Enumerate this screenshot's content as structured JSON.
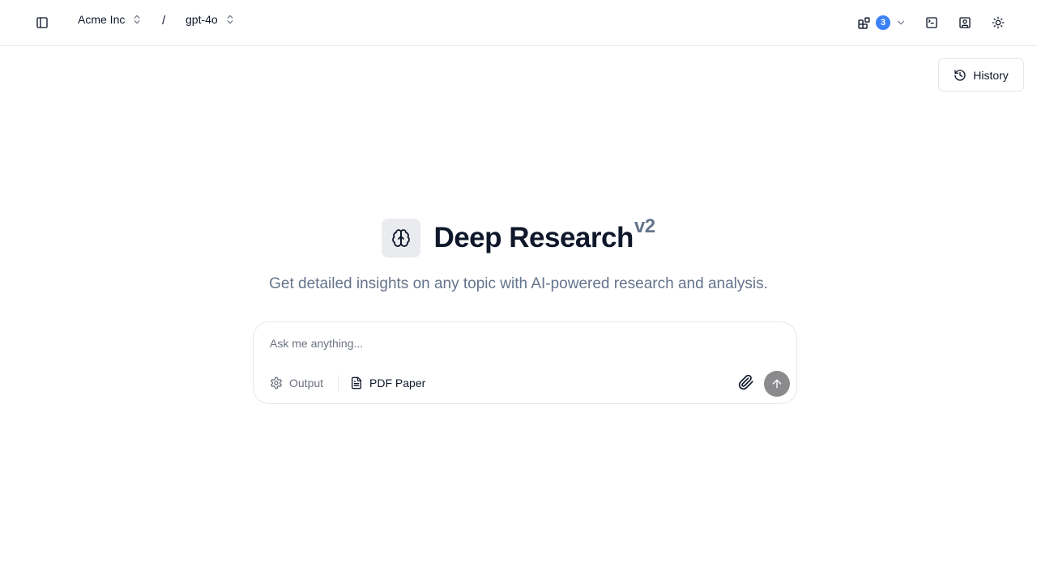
{
  "header": {
    "org_name": "Acme Inc",
    "separator": "/",
    "model_name": "gpt-4o",
    "apps_badge_count": "3"
  },
  "history": {
    "label": "History"
  },
  "hero": {
    "title": "Deep Research",
    "version": "v2",
    "subtitle": "Get detailed insights on any topic with AI-powered research and analysis."
  },
  "composer": {
    "placeholder": "Ask me anything...",
    "value": "",
    "output_label": "Output",
    "format_label": "PDF Paper"
  },
  "colors": {
    "badge": "#3b82f6",
    "send_button": "#8b8b8e",
    "muted_text": "#64748b"
  },
  "icons": {
    "sidebar_toggle": "panel-left-icon",
    "org_chevron": "chevrons-up-down-icon",
    "apps": "blocks-icon",
    "terminal": "terminal-icon",
    "profile": "user-square-icon",
    "theme": "sun-icon",
    "history": "history-icon",
    "brand": "brain-icon",
    "output": "gear-icon",
    "format": "file-text-icon",
    "attach": "paperclip-icon",
    "send": "arrow-up-icon"
  }
}
